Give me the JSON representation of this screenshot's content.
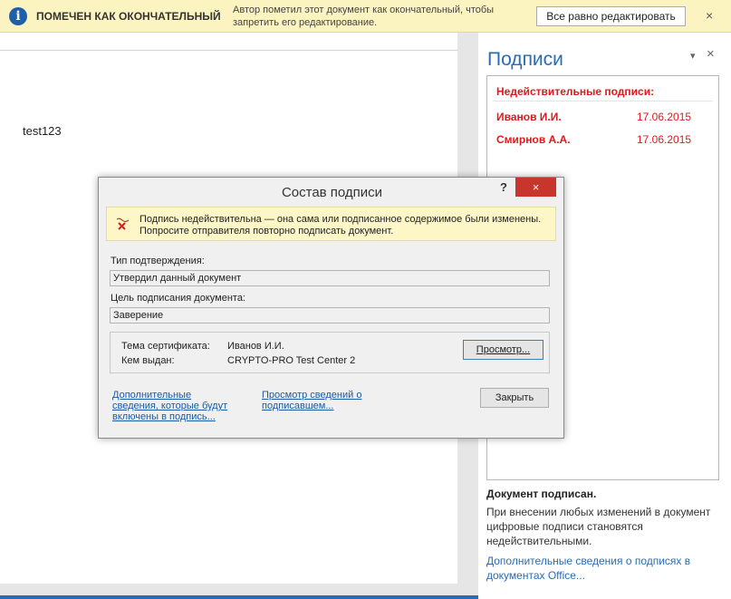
{
  "infobar": {
    "icon": "info-icon",
    "title": "ПОМЕЧЕН КАК ОКОНЧАТЕЛЬНЫЙ",
    "message": "Автор пометил этот документ как окончательный, чтобы запретить его редактирование.",
    "edit_button": "Все равно редактировать",
    "close_icon": "×"
  },
  "document": {
    "text": "test123"
  },
  "signatures_pane": {
    "title": "Подписи",
    "pin_icon": "▾",
    "close_icon": "×",
    "invalid_header": "Недействительные подписи:",
    "signatures": [
      {
        "name": "Иванов И.И.",
        "date": "17.06.2015"
      },
      {
        "name": "Смирнов А.А.",
        "date": "17.06.2015"
      }
    ],
    "status_title": "Документ подписан.",
    "status_text": "При внесении любых изменений в документ цифровые подписи становятся недействительными.",
    "link": "Дополнительные сведения о подписях в документах Office..."
  },
  "dialog": {
    "title": "Состав подписи",
    "help": "?",
    "close": "×",
    "warning": "Подпись недействительна — она сама или подписанное содержимое были изменены. Попросите отправителя повторно подписать документ.",
    "commitment_label": "Тип подтверждения:",
    "commitment_value": "Утвердил данный документ",
    "purpose_label": "Цель подписания документа:",
    "purpose_value": "Заверение",
    "cert_subject_label": "Тема сертификата:",
    "cert_subject_value": "Иванов И.И.",
    "cert_issuer_label": "Кем выдан:",
    "cert_issuer_value": "CRYPTO-PRO Test Center 2",
    "view_button": "Просмотр...",
    "extra_link": "Дополнительные сведения, которые будут включены в подпись...",
    "signer_link": "Просмотр сведений о подписавшем...",
    "close_button": "Закрыть"
  },
  "colors": {
    "accent": "#2a6cb3",
    "error": "#e0191c",
    "infobar_bg": "#fcf4c0",
    "dialog_close": "#c7352d"
  }
}
